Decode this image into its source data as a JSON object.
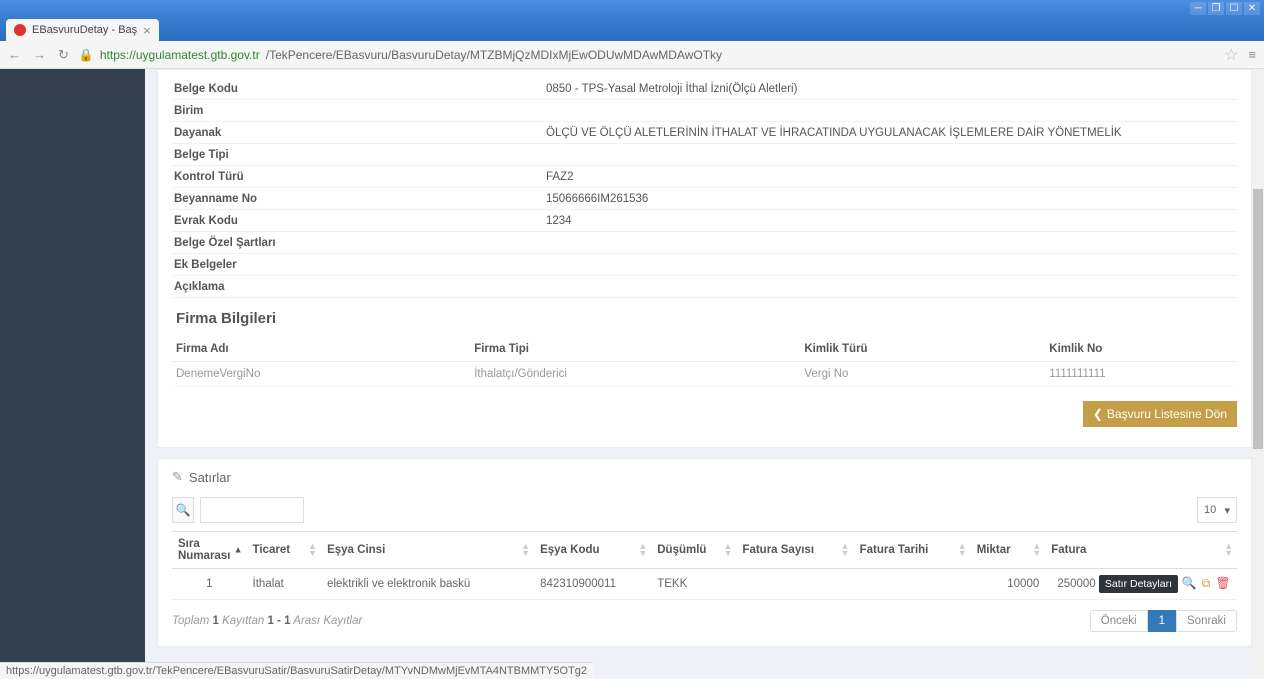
{
  "browser": {
    "tab_title": "EBasvuruDetay - Baş",
    "url_host": "https://uygulamatest.gtb.gov.tr",
    "url_path": "/TekPencere/EBasvuru/BasvuruDetay/MTZBMjQzMDIxMjEwODUwMDAwMDAwOTky",
    "status_url": "https://uygulamatest.gtb.gov.tr/TekPencere/EBasvuruSatir/BasvuruSatirDetay/MTYvNDMwMjEvMTA4NTBMMTY5OTg2"
  },
  "detail": {
    "rows": [
      {
        "label": "Belge Kodu",
        "value": "0850 - TPS-Yasal Metroloji İthal İzni(Ölçü Aletleri)"
      },
      {
        "label": "Birim",
        "value": ""
      },
      {
        "label": "Dayanak",
        "value": "ÖLÇÜ VE ÖLÇÜ ALETLERİNİN İTHALAT VE İHRACATINDA UYGULANACAK İŞLEMLERE DAİR YÖNETMELİK"
      },
      {
        "label": "Belge Tipi",
        "value": ""
      },
      {
        "label": "Kontrol Türü",
        "value": "FAZ2"
      },
      {
        "label": "Beyanname No",
        "value": "15066666IM261536"
      },
      {
        "label": "Evrak Kodu",
        "value": "1234"
      },
      {
        "label": "Belge Özel Şartları",
        "value": ""
      },
      {
        "label": "Ek Belgeler",
        "value": ""
      },
      {
        "label": "Açıklama",
        "value": ""
      }
    ]
  },
  "firma": {
    "title": "Firma Bilgileri",
    "headers": {
      "ad": "Firma Adı",
      "tip": "Firma Tipi",
      "kimlik_turu": "Kimlik Türü",
      "kimlik_no": "Kimlik No"
    },
    "rows": [
      {
        "ad": "DenemeVergiNo",
        "tip": "İthalatçı/Gönderici",
        "kimlik_turu": "Vergi No",
        "kimlik_no": "1111111111"
      }
    ]
  },
  "buttons": {
    "back": "Başvuru Listesine Dön"
  },
  "satir": {
    "title": "Satırlar",
    "page_size": "10",
    "headers": {
      "sira": "Sıra Numarası",
      "ticaret": "Ticaret",
      "esya_cinsi": "Eşya Cinsi",
      "esya_kodu": "Eşya Kodu",
      "dusumlu": "Düşümlü",
      "fatura_sayisi": "Fatura Sayısı",
      "fatura_tarihi": "Fatura Tarihi",
      "miktar": "Miktar",
      "fatura": "Fatura"
    },
    "rows": [
      {
        "sira": "1",
        "ticaret": "İthalat",
        "esya_cinsi": "elektrikli ve elektronik baskü",
        "esya_kodu": "842310900011",
        "dusumlu": "TEKK",
        "fatura_sayisi": "",
        "fatura_tarihi": "",
        "miktar": "10000",
        "fatura": "250000"
      }
    ],
    "tooltip": "Satır Detayları",
    "footer": {
      "t1": "Toplam ",
      "total": "1",
      "t2": " Kayıttan ",
      "range": "1 - 1",
      "t3": " Arası Kayıtlar"
    },
    "pager": {
      "prev": "Önceki",
      "page": "1",
      "next": "Sonraki"
    }
  }
}
